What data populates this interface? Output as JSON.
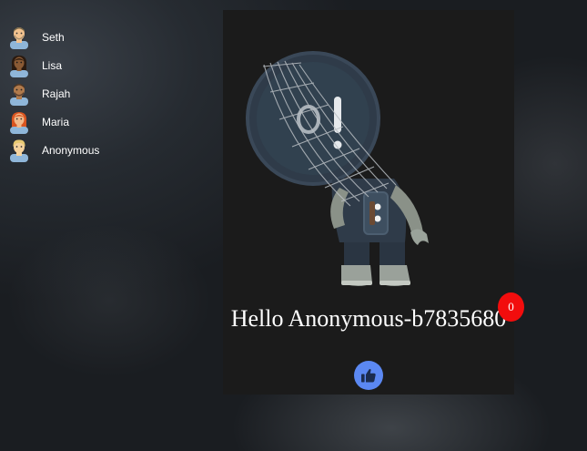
{
  "users": [
    {
      "name": "Seth",
      "avatar_icon": "man-avatar-icon",
      "skin": "#f2c28f",
      "hair": "#7a6a4a"
    },
    {
      "name": "Lisa",
      "avatar_icon": "woman-avatar-icon",
      "skin": "#8a5a34",
      "hair": "#2a1a10"
    },
    {
      "name": "Rajah",
      "avatar_icon": "man-avatar-icon",
      "skin": "#b07a4c",
      "hair": "#4a3322"
    },
    {
      "name": "Maria",
      "avatar_icon": "woman-avatar-icon",
      "skin": "#f2b98a",
      "hair": "#d9541f"
    },
    {
      "name": "Anonymous",
      "avatar_icon": "person-avatar-icon",
      "skin": "#f5d29c",
      "hair": "#e8c972"
    }
  ],
  "card": {
    "image_icon": "astronaut-illustration",
    "greeting": "Hello Anonymous-b7835680",
    "like_icon": "thumbs-up-icon"
  },
  "likes": {
    "count": "0"
  },
  "colors": {
    "like_button": "#5b88f2",
    "badge": "#f20d0d",
    "card_bg": "#1b1b1b"
  }
}
